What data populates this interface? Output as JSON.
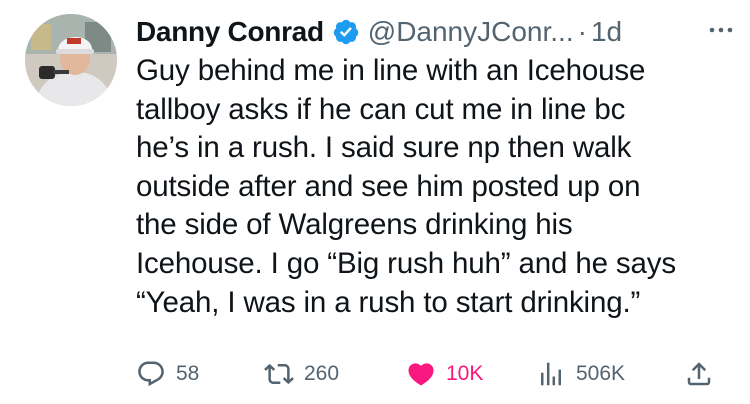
{
  "tweet": {
    "author_name": "Danny Conrad",
    "handle": "@DannyJConr...",
    "separator": "·",
    "time": "1d",
    "text": "Guy behind me in line with an Icehouse\ntallboy asks if he can cut me in line bc\nhe’s in a rush. I said sure np then walk\noutside after and see him posted up on\nthe side of Walgreens drinking his\nIcehouse. I go “Big rush huh” and he says\n“Yeah, I was in a rush to start drinking.”",
    "replies": "58",
    "reposts": "260",
    "likes": "10K",
    "views": "506K"
  },
  "colors": {
    "verified_blue": "#1d9bf0",
    "like_pink": "#f91880",
    "meta_gray": "#536471"
  },
  "icons": [
    "verified-badge-icon",
    "more-icon",
    "reply-icon",
    "repost-icon",
    "heart-icon",
    "views-icon",
    "share-icon"
  ]
}
